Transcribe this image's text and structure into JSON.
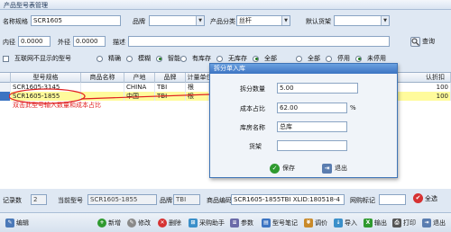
{
  "window": {
    "title": "产品型号表管理"
  },
  "form": {
    "model_label": "名称规格",
    "model_value": "SCR1605",
    "brand_label": "品牌",
    "brand_value": "",
    "category_label": "产品分类",
    "category_value": "丝杆",
    "default_shelf_label": "默认货架",
    "default_shelf_value": "",
    "inner_label": "内径",
    "inner_value": "0.0000",
    "outer_label": "外径",
    "outer_value": "0.0000",
    "desc_label": "描述",
    "desc_value": "",
    "query_label": "查询",
    "hide_label": "互联网不显示的型号",
    "match_options": [
      "精确",
      "模糊",
      "智能"
    ],
    "match_selected": 2,
    "stock_options": [
      "有库存",
      "无库存",
      "全部"
    ],
    "stock_selected": 2,
    "enable_options": [
      "全部",
      "停用",
      "未停用"
    ],
    "enable_selected": 2
  },
  "grid": {
    "columns": [
      "型号规格",
      "商品名称",
      "产地",
      "品牌",
      "计量单位",
      "认折扣"
    ],
    "rows": [
      {
        "model": "SCR1605-3145",
        "name": "",
        "origin": "CHINA",
        "brand": "TBI",
        "unit": "根",
        "discount": "100"
      },
      {
        "model": "SCR1605-1855",
        "name": "",
        "origin": "中国",
        "brand": "TBI",
        "unit": "根",
        "discount": "100"
      }
    ],
    "annotation": "双击此型号输入数量和成本占比"
  },
  "dialog": {
    "title": "拆分单入库",
    "qty_label": "拆分数量",
    "qty_value": "5.00",
    "cost_label": "成本占比",
    "cost_value": "62.00",
    "cost_unit": "%",
    "warehouse_label": "库房名称",
    "warehouse_value": "总库",
    "shelf_label": "货架",
    "shelf_value": "",
    "save_label": "保存",
    "exit_label": "退出"
  },
  "status": {
    "record_label": "记录数",
    "record_value": "2",
    "current_label": "当前型号",
    "current_value": "SCR1605-1855",
    "brand_label": "品牌",
    "brand_value": "TBI",
    "code_label": "商品编码",
    "code_value": "SCR1605-1855TBI XLID:180518-4",
    "mark_label": "网购标记",
    "mark_value": "",
    "all_label": "全选"
  },
  "toolbar": {
    "items": [
      "编辑",
      "新增",
      "修改",
      "删除",
      "采购助手",
      "参数",
      "型号笔记",
      "调价",
      "导入",
      "输出",
      "打印",
      "退出"
    ]
  },
  "colors": {
    "accent": "#3c74c2",
    "highlight_row": "#fffb9c",
    "annotation": "#e02020"
  }
}
